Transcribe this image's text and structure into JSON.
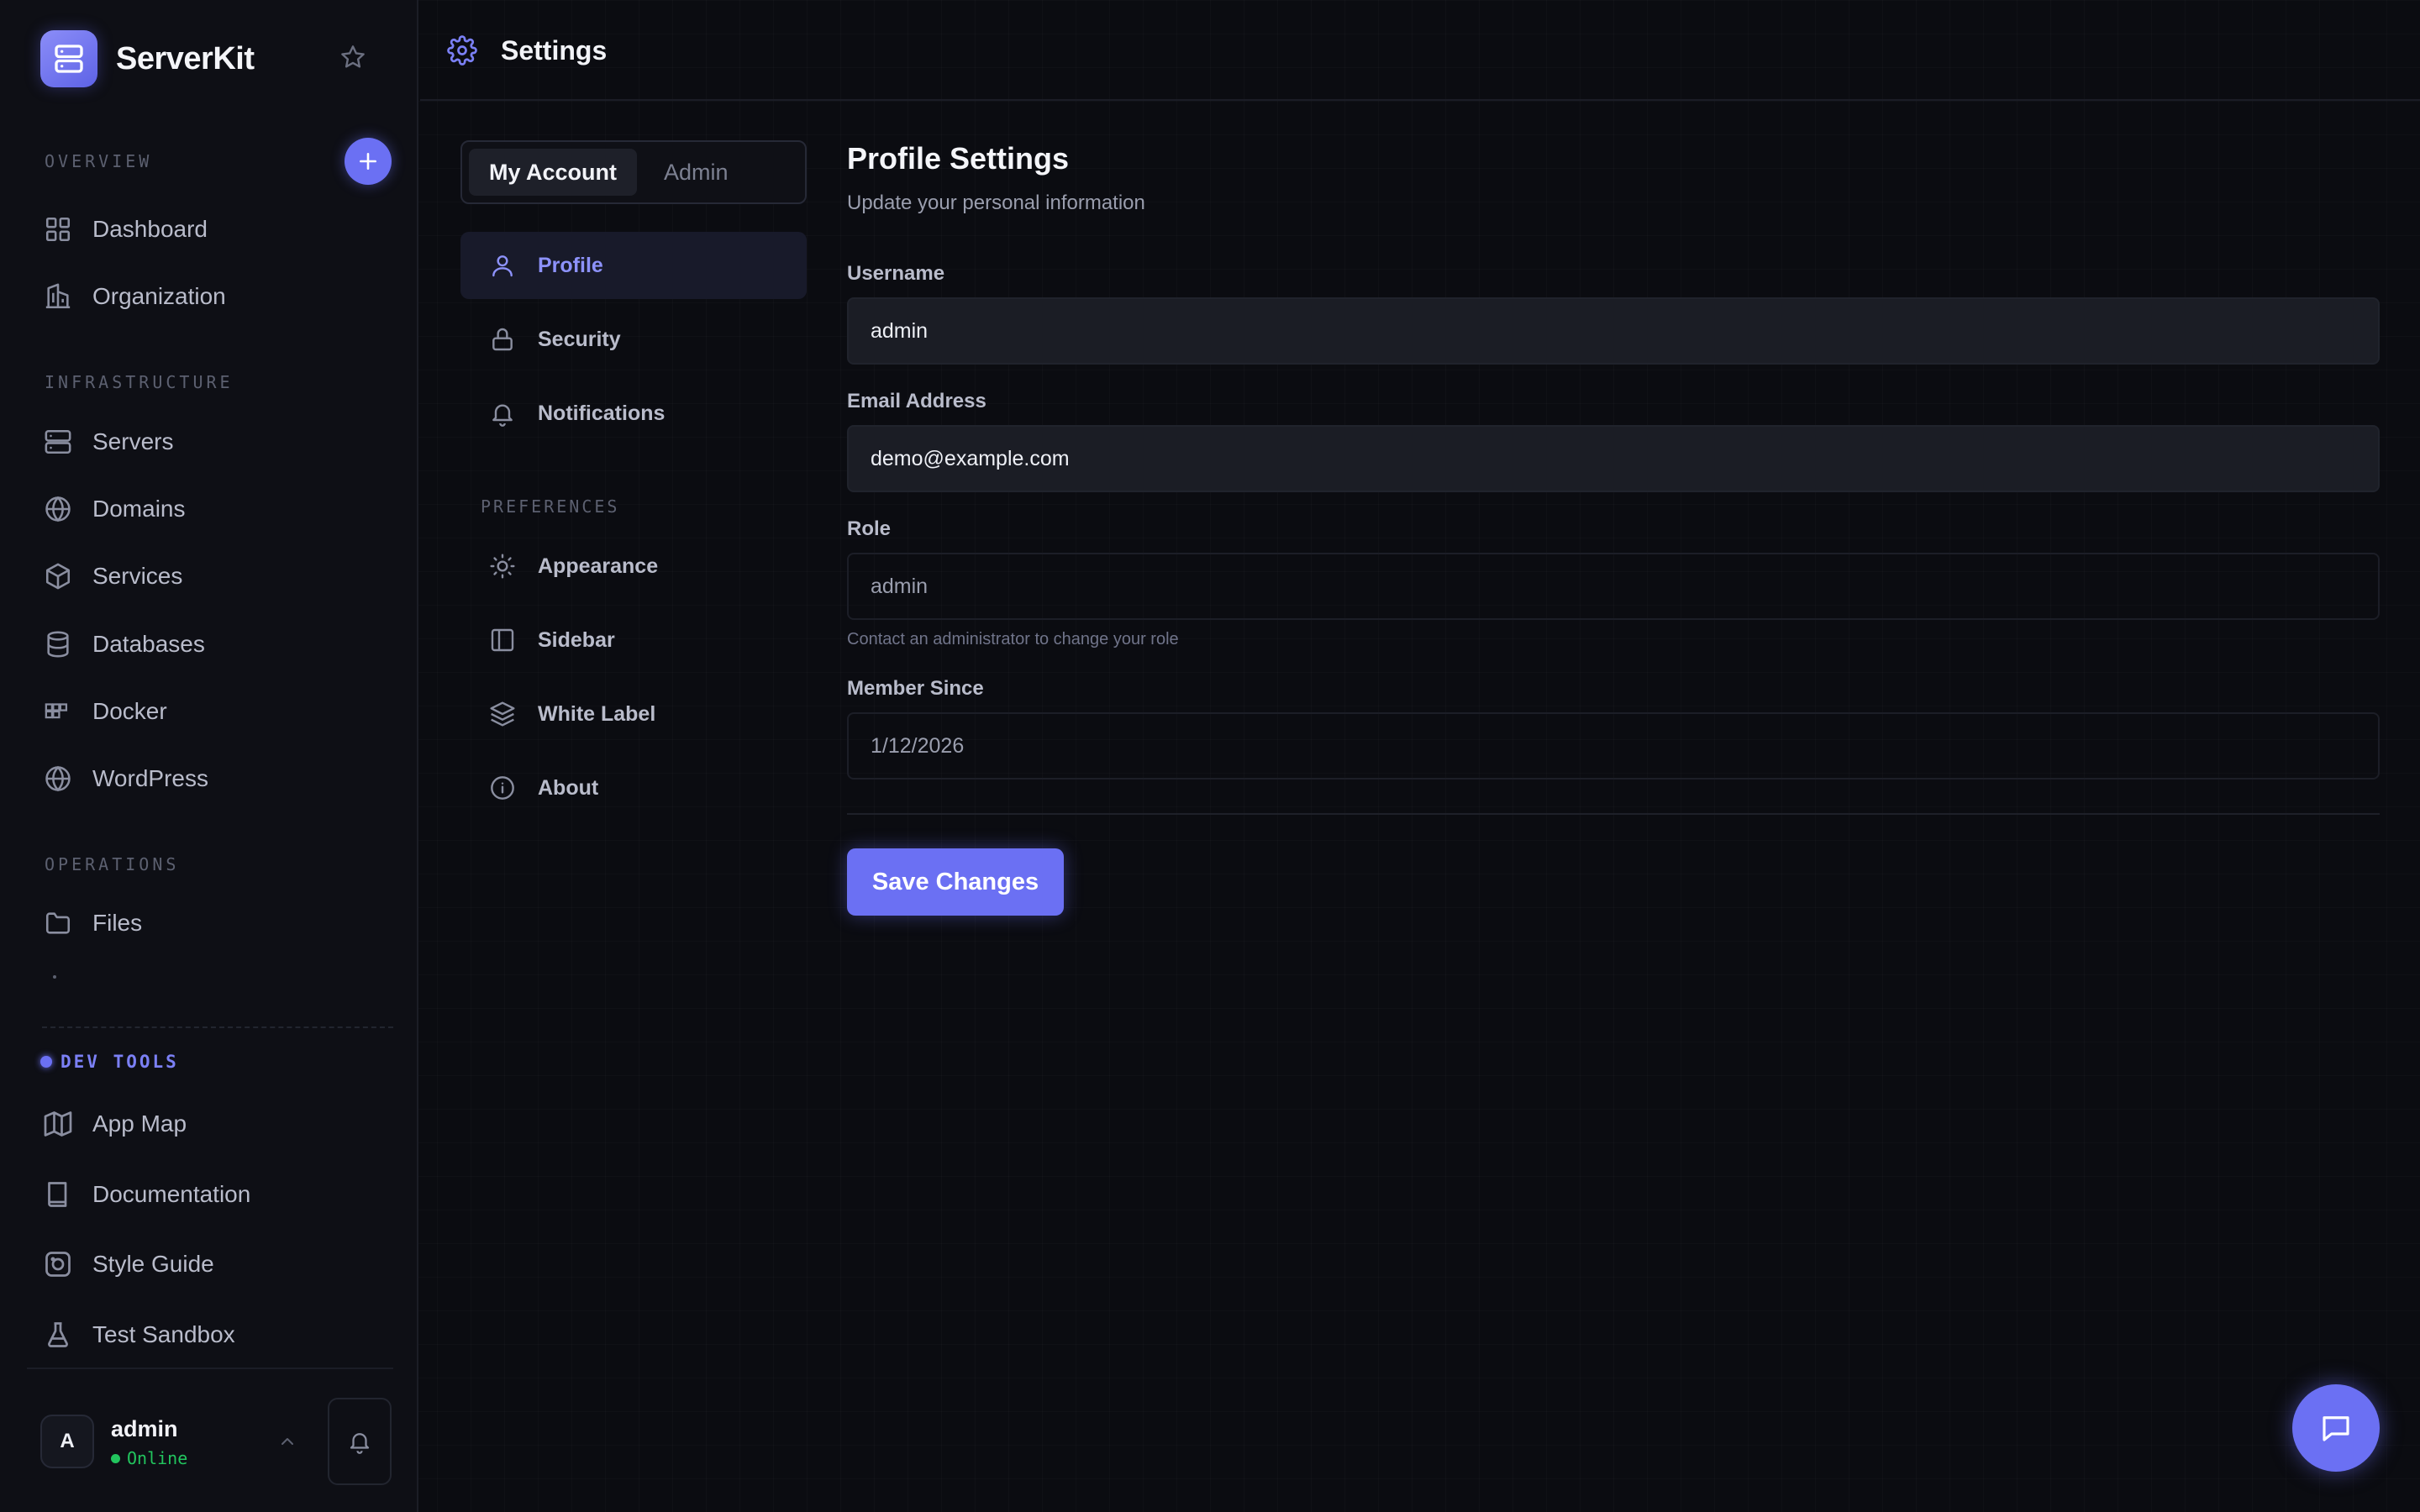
{
  "app": {
    "name": "ServerKit"
  },
  "colors": {
    "accent": "#6b70f3",
    "online": "#22c55e",
    "background": "#0b0c11"
  },
  "sidebar": {
    "sections": {
      "overview": "OVERVIEW",
      "infrastructure": "INFRASTRUCTURE",
      "operations": "OPERATIONS",
      "dev_tools": "DEV TOOLS"
    },
    "items": {
      "dashboard": "Dashboard",
      "organization": "Organization",
      "servers": "Servers",
      "domains": "Domains",
      "services": "Services",
      "databases": "Databases",
      "docker": "Docker",
      "wordpress": "WordPress",
      "files": "Files",
      "app_map": "App Map",
      "documentation": "Documentation",
      "style_guide": "Style Guide",
      "test_sandbox": "Test Sandbox"
    },
    "user": {
      "avatar_initial": "A",
      "name": "admin",
      "status": "Online"
    }
  },
  "topbar": {
    "title": "Settings",
    "icon": "gear-icon"
  },
  "settings_nav": {
    "tabs": [
      "My Account",
      "Admin"
    ],
    "active_tab": "My Account",
    "items": {
      "profile": "Profile",
      "security": "Security",
      "notifications": "Notifications",
      "appearance": "Appearance",
      "sidebar": "Sidebar",
      "white_label": "White Label",
      "about": "About"
    },
    "preferences_label": "PREFERENCES",
    "active_item": "Profile"
  },
  "profile": {
    "title": "Profile Settings",
    "subtitle": "Update your personal information",
    "username_label": "Username",
    "username_value": "admin",
    "email_label": "Email Address",
    "email_value": "demo@example.com",
    "role_label": "Role",
    "role_value": "admin",
    "role_hint": "Contact an administrator to change your role",
    "member_since_label": "Member Since",
    "member_since_value": "1/12/2026",
    "save_label": "Save Changes"
  }
}
